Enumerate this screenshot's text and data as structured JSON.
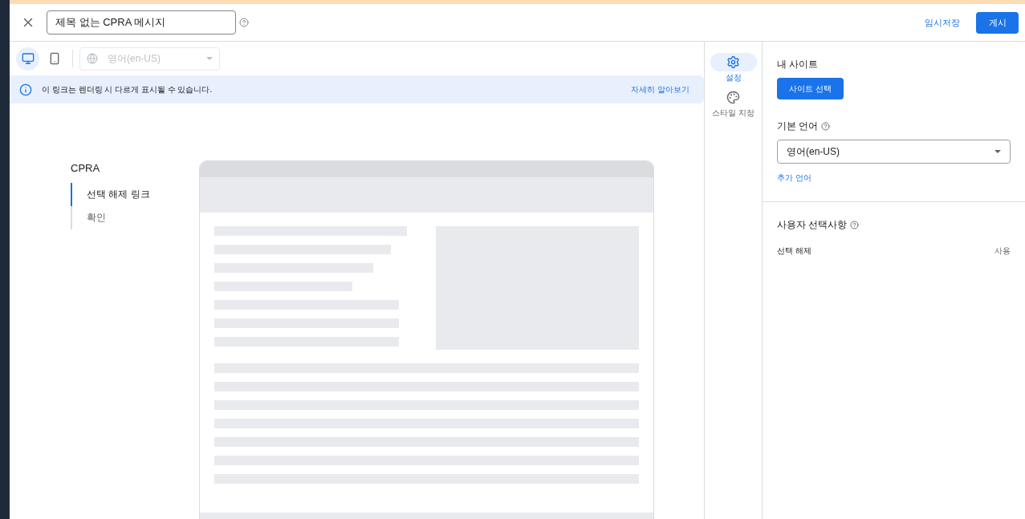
{
  "header": {
    "title_value": "제목 없는 CPRA 메시지",
    "save_draft": "임시저장",
    "publish": "게시"
  },
  "toolbar": {
    "devices": [
      {
        "kind": "desktop",
        "selected": true
      },
      {
        "kind": "mobile",
        "selected": false
      }
    ],
    "language": {
      "value": "영어(en-US)",
      "disabled": true
    }
  },
  "banner": {
    "text": "이 링크는 렌더링 시 다르게 표시될 수 있습니다.",
    "link": "자세히 알아보기"
  },
  "preview_nav": {
    "title": "CPRA",
    "items": [
      {
        "label": "선택 해제 링크",
        "selected": true
      },
      {
        "label": "확인",
        "selected": false
      }
    ]
  },
  "side_tabs": [
    {
      "kind": "settings",
      "label": "설정",
      "selected": true
    },
    {
      "kind": "style",
      "label": "스타일 지정",
      "selected": false
    }
  ],
  "settings": {
    "my_site": {
      "label": "내 사이트",
      "button": "사이트 선택"
    },
    "default_language": {
      "label": "기본 언어",
      "value": "영어(en-US)",
      "add_link": "추가 언어"
    },
    "user_choices": {
      "label": "사용자 선택사항",
      "rows": [
        {
          "label": "선택 해제",
          "value": "사용"
        }
      ]
    }
  }
}
